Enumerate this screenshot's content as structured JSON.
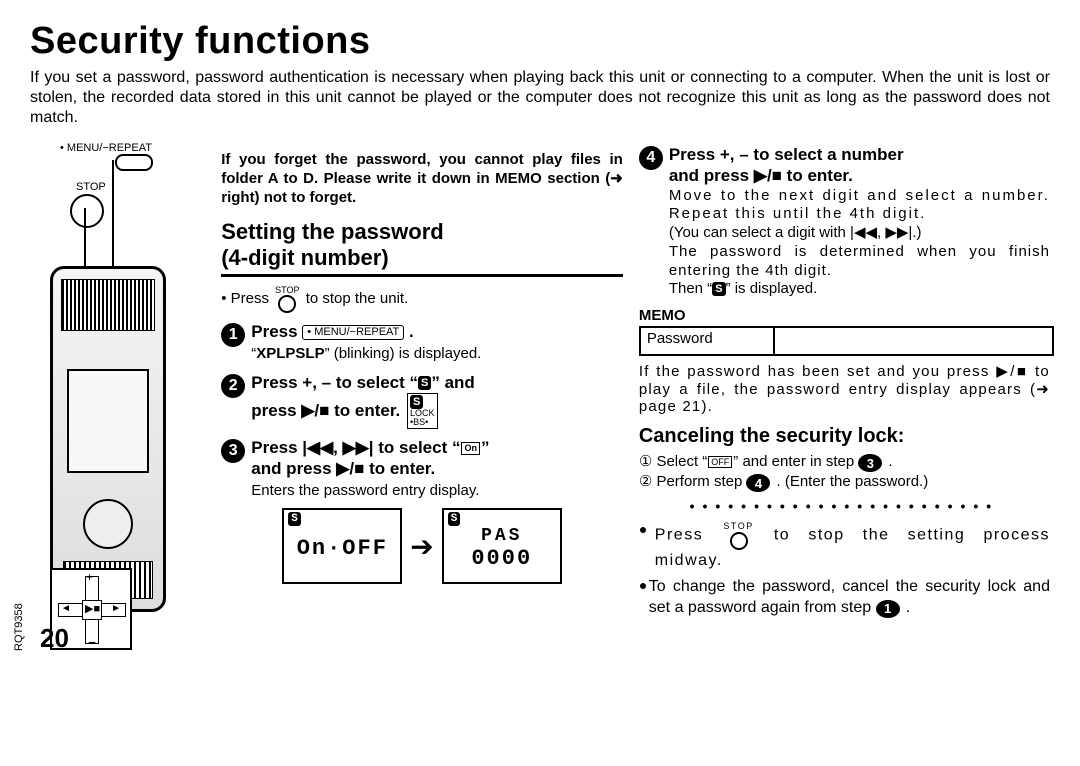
{
  "page_number": "20",
  "doc_code": "RQT9358",
  "title": "Security functions",
  "intro": "If you set a password, password authentication is necessary when playing back this unit or connecting to a computer. When the unit is lost or stolen, the recorded data stored in this unit cannot be played or the computer does not recognize this unit as long as the password does not match.",
  "device": {
    "menu_repeat_label": "• MENU/−REPEAT",
    "stop_label": "STOP",
    "pad_plus": "+",
    "pad_minus": "−",
    "pad_center": "▶■"
  },
  "forget_note": "If you forget the password, you cannot play files in folder A to D. Please write it down in MEMO section (➜ right) not to forget.",
  "setting_heading_l1": "Setting the password",
  "setting_heading_l2": "(4-digit number)",
  "pre_step": "• Press",
  "pre_step_tail": "to stop the unit.",
  "step1": {
    "num": "1",
    "lead": "Press",
    "btn": "• MENU/−REPEAT",
    "tail": ".",
    "note_pre": "“",
    "note_seg": "XPLPSLP",
    "note_post": "” (blinking) is displayed."
  },
  "step2": {
    "num": "2",
    "line1a": "Press +, – to select “",
    "line1b": "” and",
    "line2a": "press ",
    "line2b": " to enter.",
    "badge_top": "LOCK",
    "badge_bot": "•BS•"
  },
  "step3": {
    "num": "3",
    "l1a": "Press ",
    "l1b": " to select “",
    "l1c": "”",
    "on_sym": "On",
    "l2a": "and press ",
    "l2b": " to enter.",
    "note": "Enters the password entry display."
  },
  "lcd": {
    "left_top": "S",
    "left_main": "On·OFF",
    "right_top": "S",
    "right_lbl": "PAS",
    "right_digits": "0000"
  },
  "step4": {
    "num": "4",
    "l1": "Press +, – to select a number",
    "l2a": "and press ",
    "l2b": " to enter.",
    "p1": "Move to the next digit and select a number. Repeat this until the 4th digit.",
    "p2a": "(You can select a digit with ",
    "p2b": ".)",
    "p3": "The password is determined when you finish entering the 4th digit.",
    "p4a": "Then “",
    "p4b": "” is displayed."
  },
  "memo": {
    "head": "MEMO",
    "label": "Password"
  },
  "after_memo": {
    "t1a": "If the password has been set and you press ",
    "t1b": " to play a file, the password entry display appears (➜ page 21)."
  },
  "cancel": {
    "head": "Canceling the security lock:",
    "r1a": "① Select “",
    "r1seg": "OFF",
    "r1b": "” and enter in step ",
    "r1num": "3",
    "r1c": ".",
    "r2a": "② Perform step ",
    "r2num": "4",
    "r2b": ". (Enter the password.)"
  },
  "tips": {
    "t1a": "Press",
    "t1b": "to stop the setting process midway.",
    "t2a": "To change the password, cancel the security lock and set a password again from step ",
    "t2num": "1",
    "t2b": "."
  },
  "sym": {
    "play_stop": "▶/■",
    "rew": "|◀◀",
    "ff": "▶▶|",
    "rew_ff": "|◀◀, ▶▶|",
    "s_icon": "S"
  }
}
